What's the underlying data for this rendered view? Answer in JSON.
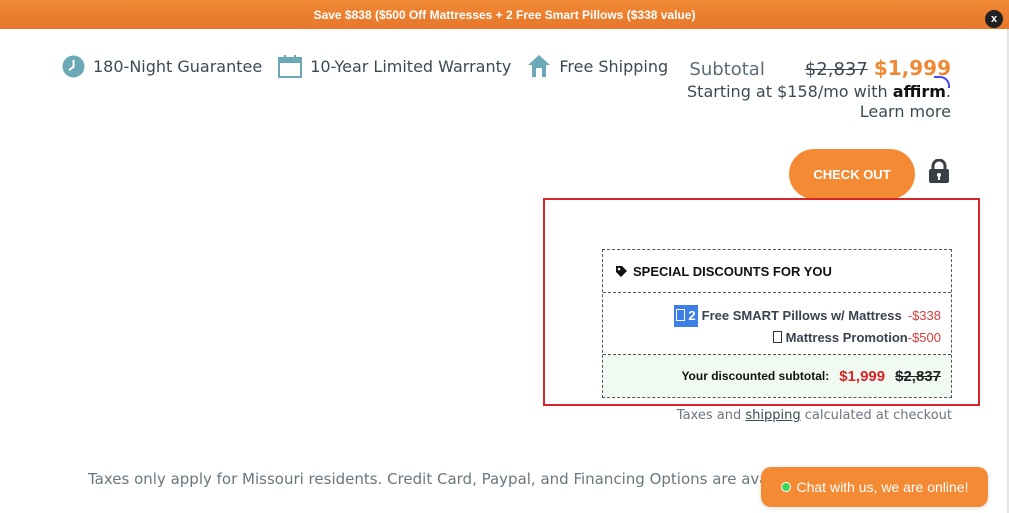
{
  "promo": {
    "text": "Save $838 ($500 Off Mattresses + 2 Free Smart Pillows ($338 value)",
    "close_label": "x"
  },
  "perks": [
    {
      "label": "180-Night Guarantee",
      "icon": "clock-icon"
    },
    {
      "label": "10-Year Limited Warranty",
      "icon": "calendar-icon"
    },
    {
      "label": "Free Shipping",
      "icon": "house-icon"
    }
  ],
  "subtotal": {
    "label": "Subtotal",
    "original": "$2,837",
    "price": "$1,999",
    "financing_prefix": "Starting at $158/mo with",
    "financing_brand": "affirm",
    "learn_more": "Learn more"
  },
  "checkout": {
    "label": "CHECK OUT",
    "icon": "lock-icon"
  },
  "discounts": {
    "title": "SPECIAL DISCOUNTS FOR YOU",
    "items": [
      {
        "qty": "2",
        "label": "Free SMART Pillows w/ Mattress",
        "amount": "-$338"
      },
      {
        "label": "Mattress Promotion",
        "amount": "-$500"
      }
    ],
    "total_label": "Your discounted subtotal:",
    "total_price": "$1,999",
    "total_original": "$2,837"
  },
  "taxes_note": {
    "prefix": "Taxes and",
    "link": "shipping",
    "suffix": "calculated at checkout"
  },
  "footer": {
    "text": "Taxes only apply for Missouri residents. Credit Card, Paypal, and Financing Options are available at checkout."
  },
  "chat": {
    "label": "Chat with us, we are online!"
  },
  "colors": {
    "accent": "#f58a34",
    "highlight": "#d6262a",
    "discount_red": "#d63c3c"
  }
}
